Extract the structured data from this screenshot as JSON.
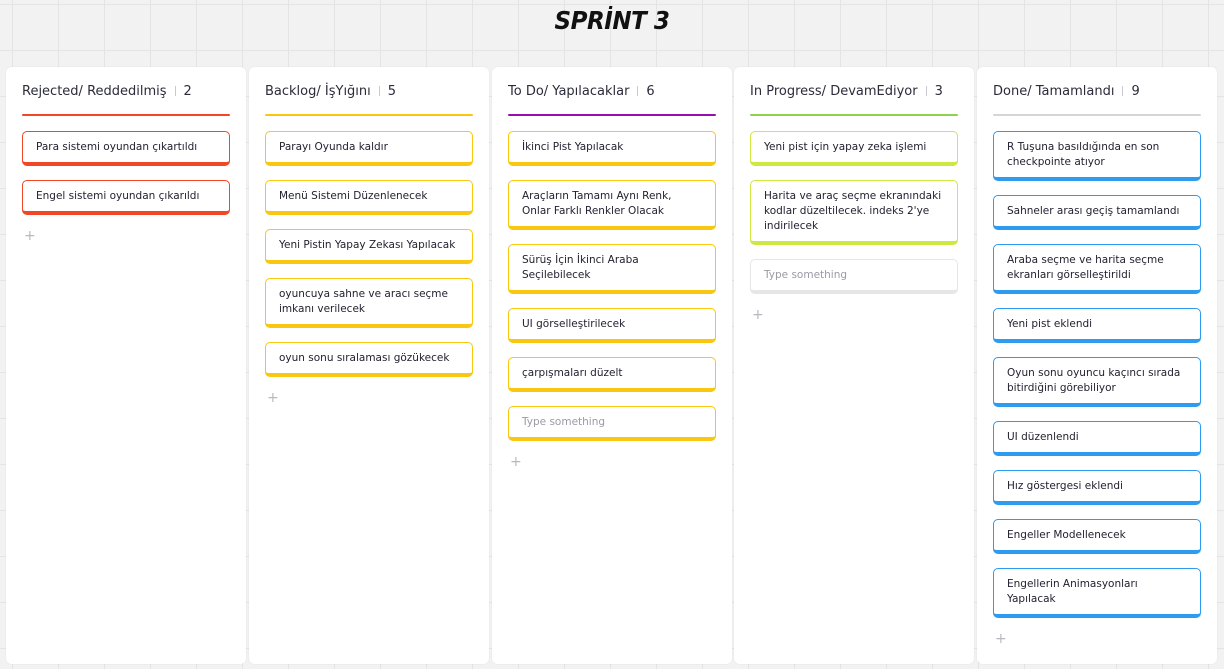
{
  "board": {
    "title": "SPRİNT 3"
  },
  "columns": [
    {
      "id": "rejected",
      "title": "Rejected/ Reddedilmiş",
      "count": "2",
      "color": "#f24726",
      "cards": [
        "Para sistemi oyundan çıkartıldı",
        "Engel sistemi oyundan çıkarıldı"
      ],
      "placeholder": "",
      "add_label": "+"
    },
    {
      "id": "backlog",
      "title": "Backlog/ İşYığını",
      "count": "5",
      "color": "#fac710",
      "cards": [
        "Parayı Oyunda kaldır",
        "Menü Sistemi Düzenlenecek",
        "Yeni Pistin Yapay Zekası Yapılacak",
        "oyuncuya sahne ve aracı seçme imkanı verilecek",
        "oyun sonu sıralaması gözükecek"
      ],
      "placeholder": "",
      "add_label": "+"
    },
    {
      "id": "todo",
      "title": "To Do/ Yapılacaklar",
      "count": "6",
      "color": "#9510ac",
      "card_color": "#fac710",
      "cards": [
        "İkinci Pist Yapılacak",
        "Araçların Tamamı Aynı Renk, Onlar Farklı Renkler Olacak",
        "Sürüş İçin İkinci Araba Seçilebilecek",
        "UI görselleştirilecek",
        "çarpışmaları düzelt"
      ],
      "placeholder": "Type something",
      "add_label": "+"
    },
    {
      "id": "in-progress",
      "title": "In Progress/ DevamEdiyor",
      "count": "3",
      "color": "#8fd14f",
      "card_color": "#cee741",
      "cards": [
        "Yeni pist için yapay zeka işlemi",
        "Harita ve araç seçme ekranındaki kodlar düzeltilecek. indeks 2'ye indirilecek"
      ],
      "placeholder": "Type something",
      "placeholder_color": "#e6e6e6",
      "add_label": "+"
    },
    {
      "id": "done",
      "title": "Done/ Tamamlandı",
      "count": "9",
      "color": "#d5d5d8",
      "card_color": "#2d9bf0",
      "cards": [
        "R Tuşuna basıldığında en son checkpointe atıyor",
        "Sahneler arası geçiş tamamlandı",
        "Araba seçme ve harita seçme ekranları görselleştirildi",
        "Yeni pist eklendi",
        "Oyun sonu oyuncu kaçıncı sırada bitirdiğini görebiliyor",
        "UI düzenlendi",
        "Hız göstergesi eklendi",
        "Engeller Modellenecek",
        "Engellerin Animasyonları Yapılacak"
      ],
      "placeholder": "",
      "add_label": "+"
    }
  ]
}
